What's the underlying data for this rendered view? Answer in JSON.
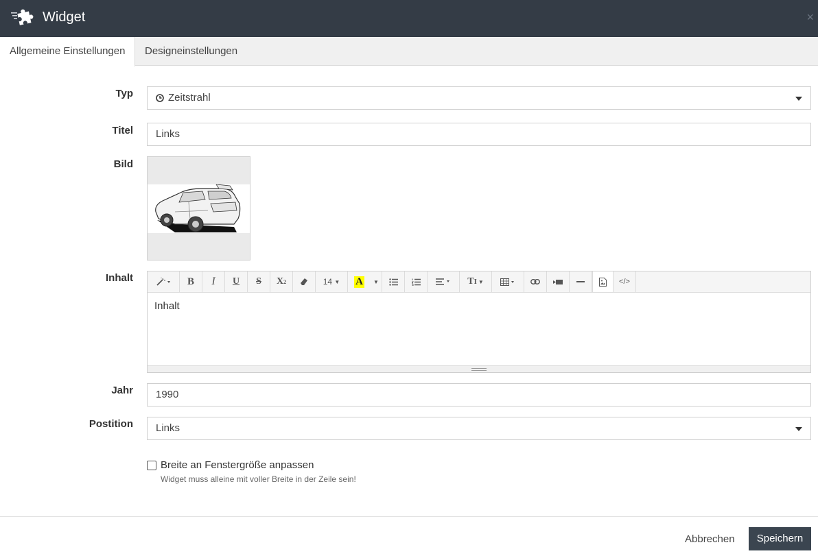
{
  "header": {
    "title": "Widget",
    "logo_icon": "puzzle-icon",
    "close_label": "×"
  },
  "tabs": [
    {
      "label": "Allgemeine Einstellungen",
      "active": true
    },
    {
      "label": "Designeinstellungen",
      "active": false
    }
  ],
  "form": {
    "type": {
      "label": "Typ",
      "value": "Zeitstrahl",
      "icon": "clock-icon"
    },
    "title": {
      "label": "Titel",
      "value": "Links"
    },
    "image": {
      "label": "Bild",
      "icon": "car-image"
    },
    "content": {
      "label": "Inhalt",
      "text": "Inhalt",
      "font_size": "14",
      "toolbar": [
        "magic-wand",
        "bold",
        "italic",
        "underline",
        "strikethrough",
        "superscript",
        "eraser",
        "font-size",
        "text-color",
        "color-dropdown",
        "unordered-list",
        "ordered-list",
        "paragraph-align",
        "line-height",
        "table",
        "link",
        "video",
        "horizontal-rule",
        "picture",
        "code-view"
      ]
    },
    "year": {
      "label": "Jahr",
      "value": "1990"
    },
    "position": {
      "label": "Postition",
      "value": "Links"
    },
    "fullwidth": {
      "label": "Breite an Fenstergröße anpassen",
      "hint": "Widget muss alleine mit voller Breite in der Zeile sein!",
      "checked": false
    }
  },
  "footer": {
    "cancel_label": "Abbrechen",
    "save_label": "Speichern"
  },
  "colors": {
    "header_bg": "#343c46",
    "save_bg": "#3b4550",
    "highlight": "#ffff00"
  }
}
